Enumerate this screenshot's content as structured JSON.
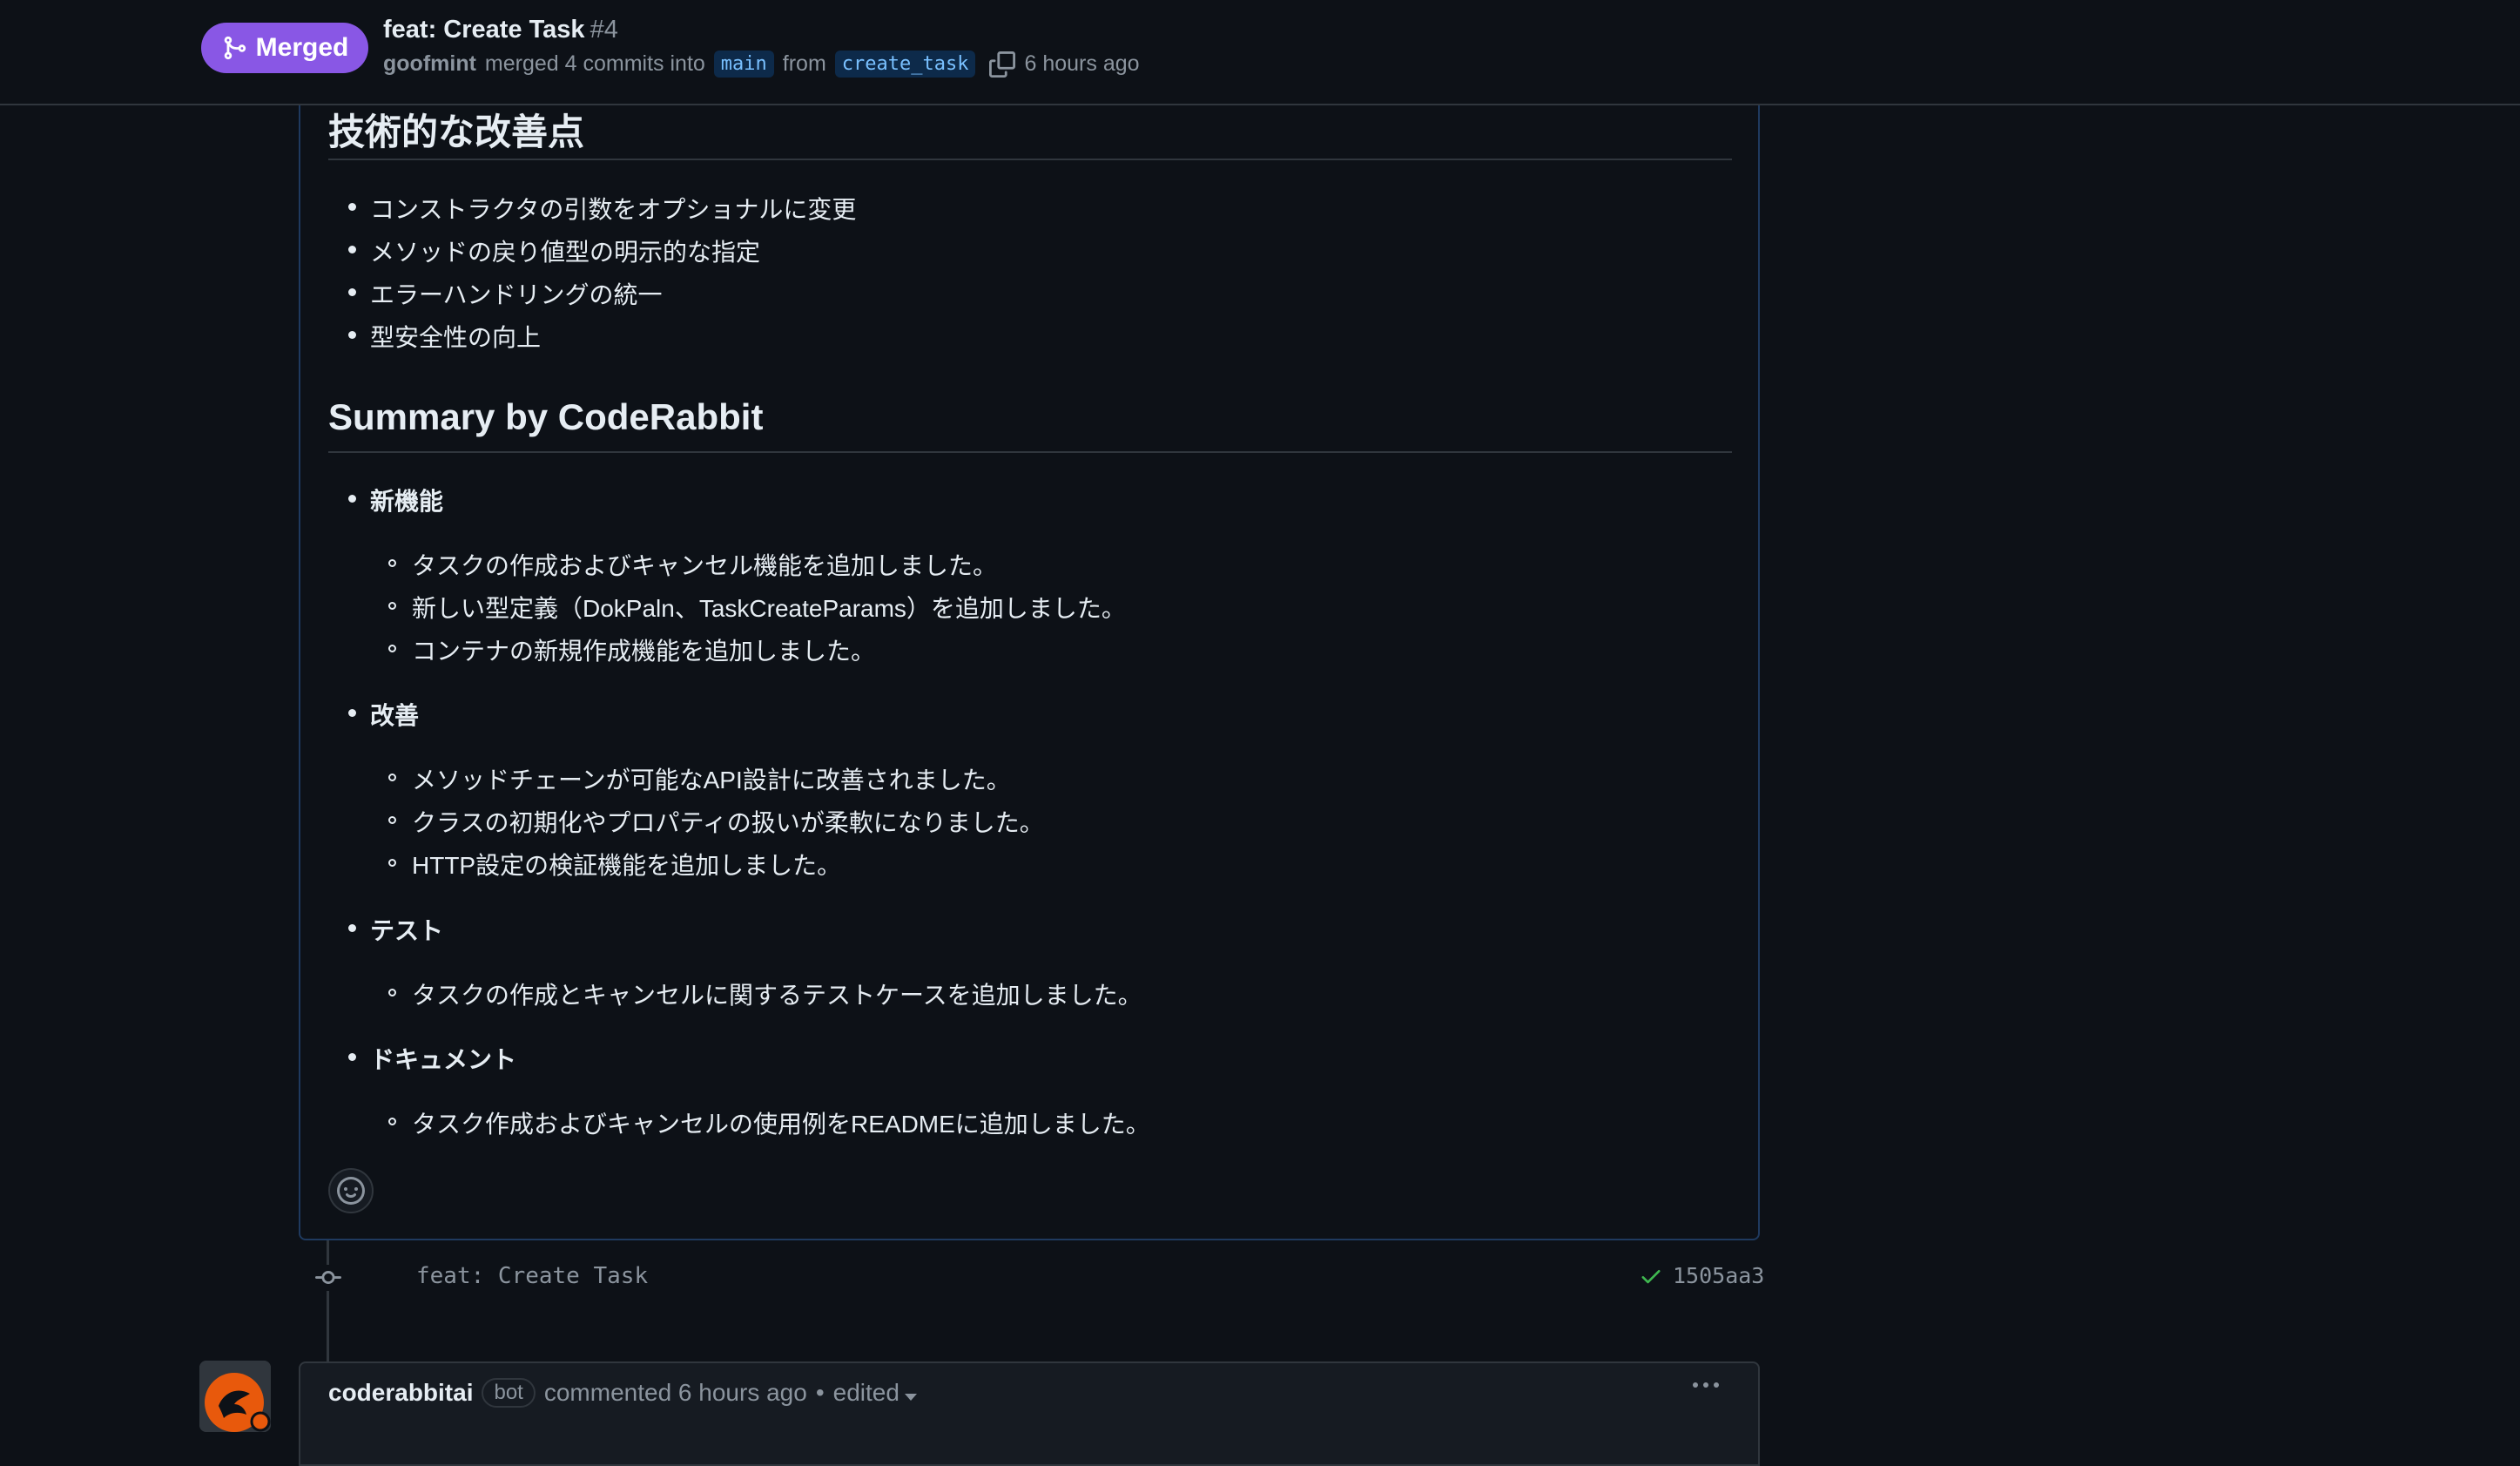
{
  "header": {
    "status_label": "Merged",
    "title": "feat: Create Task",
    "number": "#4",
    "author": "goofmint",
    "merge_text": "merged 4 commits into",
    "base_branch": "main",
    "from_text": "from",
    "head_branch": "create_task",
    "time": "6 hours ago"
  },
  "body": {
    "section1": {
      "heading": "技術的な改善点",
      "items": [
        "コンストラクタの引数をオプショナルに変更",
        "メソッドの戻り値型の明示的な指定",
        "エラーハンドリングの統一",
        "型安全性の向上"
      ]
    },
    "section2": {
      "heading": "Summary by CodeRabbit",
      "groups": [
        {
          "title": "新機能",
          "items": [
            "タスクの作成およびキャンセル機能を追加しました。",
            "新しい型定義（DokPaln、TaskCreateParams）を追加しました。",
            "コンテナの新規作成機能を追加しました。"
          ]
        },
        {
          "title": "改善",
          "items": [
            "メソッドチェーンが可能なAPI設計に改善されました。",
            "クラスの初期化やプロパティの扱いが柔軟になりました。",
            "HTTP設定の検証機能を追加しました。"
          ]
        },
        {
          "title": "テスト",
          "items": [
            "タスクの作成とキャンセルに関するテストケースを追加しました。"
          ]
        },
        {
          "title": "ドキュメント",
          "items": [
            "タスク作成およびキャンセルの使用例をREADMEに追加しました。"
          ]
        }
      ]
    }
  },
  "timeline": {
    "commit_message": "feat: Create Task",
    "commit_sha": "1505aa3"
  },
  "next_comment": {
    "author": "coderabbitai",
    "badge": "bot",
    "action": "commented 6 hours ago",
    "separator": "•",
    "edited": "edited"
  },
  "colors": {
    "merged": "#8957e5",
    "background": "#0d1117",
    "check": "#3fb950",
    "avatar_accent": "#e8590c"
  },
  "icons": {
    "merged": "git-merge-icon",
    "copy": "copy-icon",
    "reaction": "smiley-icon",
    "commit": "git-commit-icon",
    "status": "check-icon",
    "menu": "kebab-horizontal-icon"
  }
}
